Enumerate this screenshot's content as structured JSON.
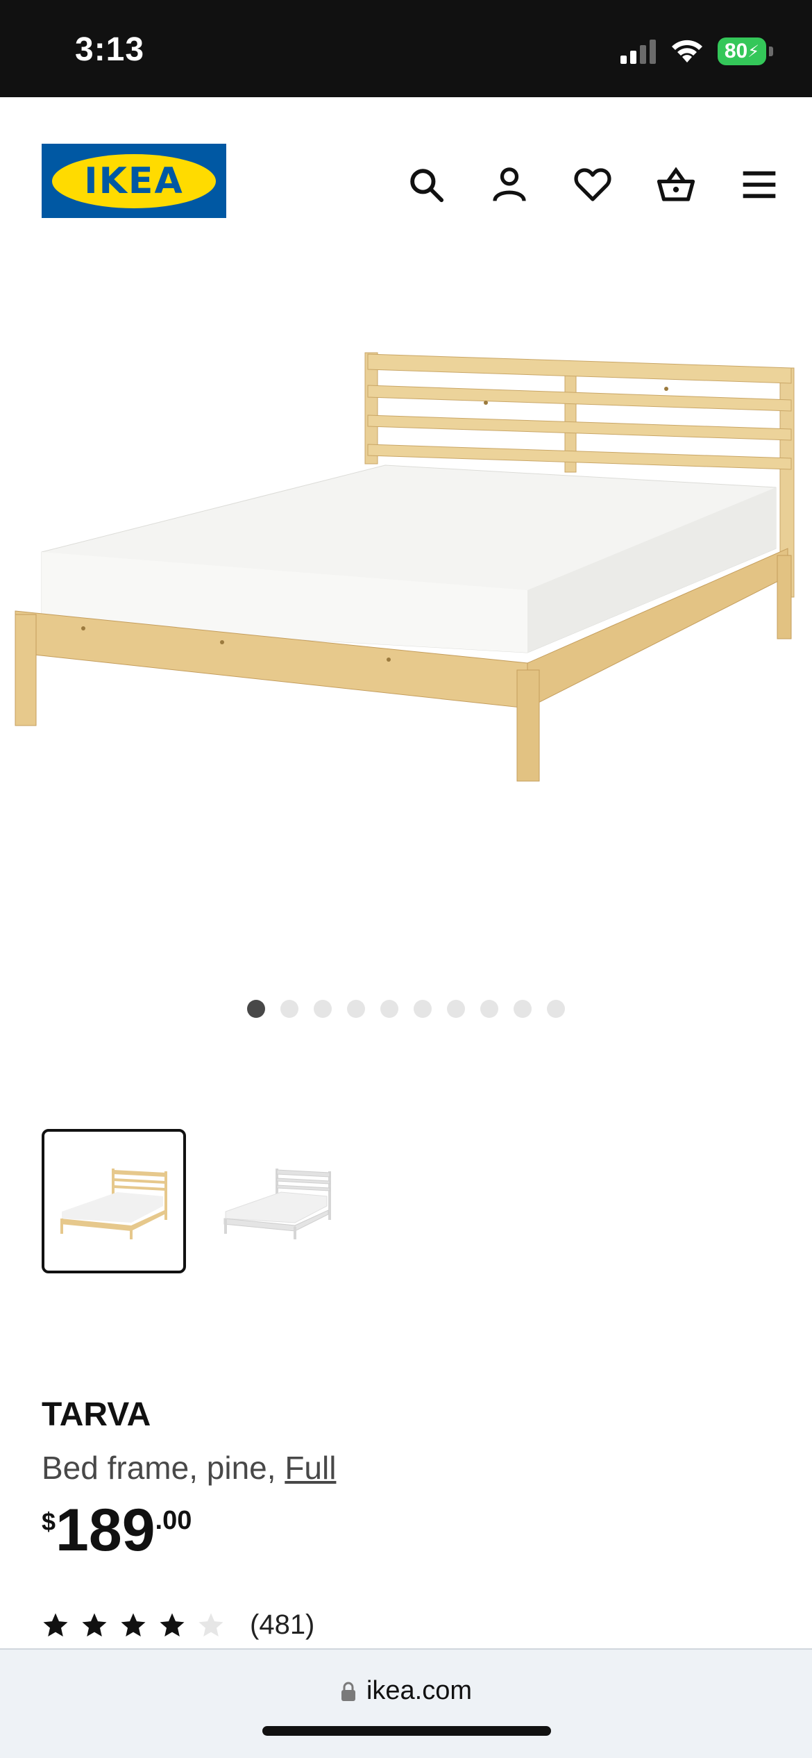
{
  "status_bar": {
    "time": "3:13",
    "battery": "80",
    "icons": [
      "signal-icon",
      "wifi-icon",
      "battery-charging-icon"
    ]
  },
  "header": {
    "logo_text": "IKEA",
    "icons": [
      "search-icon",
      "account-icon",
      "heart-icon",
      "cart-icon",
      "menu-icon"
    ]
  },
  "gallery": {
    "dot_count": 10,
    "active_dot": 1
  },
  "variants": [
    {
      "name": "pine",
      "selected": true
    },
    {
      "name": "white",
      "selected": false
    }
  ],
  "product": {
    "name": "TARVA",
    "description_prefix": "Bed frame, pine,",
    "size_link": "Full",
    "price_currency": "$",
    "price_int": "189",
    "price_dec": ".00",
    "rating": 4,
    "rating_max": 5,
    "rating_count": "(481)"
  },
  "browser": {
    "url": "ikea.com"
  },
  "colors": {
    "ikea_blue": "#0058a3",
    "ikea_yellow": "#ffdb00",
    "battery_green": "#34c759"
  }
}
